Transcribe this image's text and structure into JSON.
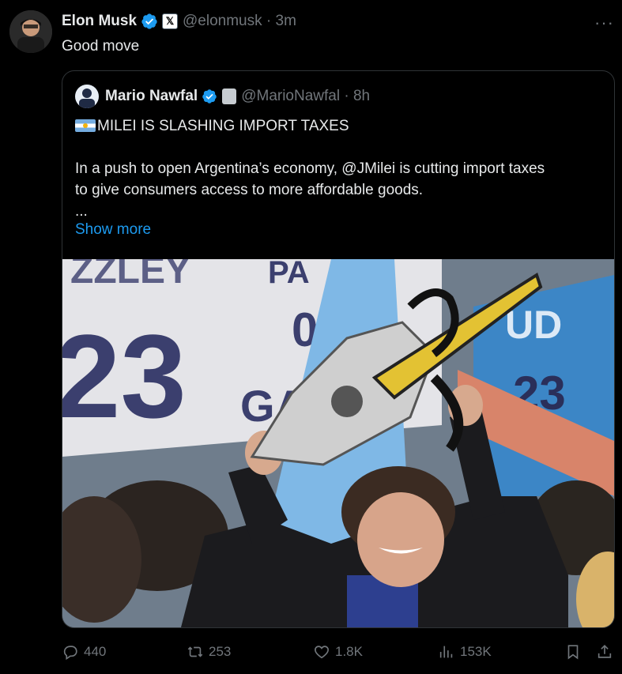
{
  "tweet": {
    "author_name": "Elon Musk",
    "handle": "@elonmusk",
    "separator": "·",
    "time": "3m",
    "text": "Good move",
    "more_icon": "more-horizontal-icon",
    "affiliation_badge": "𝕏"
  },
  "quoted": {
    "author_name": "Mario Nawfal",
    "handle": "@MarioNawfal",
    "separator": "·",
    "time": "8h",
    "headline": "MILEI IS SLASHING IMPORT TAXES",
    "line1": "In a push to open Argentina’s economy, @JMilei is cutting import taxes",
    "line2": "to give consumers access to more affordable goods.",
    "ellipsis": "...",
    "show_more": "Show more",
    "flag_icon": "argentina-flag-icon"
  },
  "actions": {
    "replies": "440",
    "reposts": "253",
    "likes": "1.8K",
    "views": "153K"
  },
  "colors": {
    "background": "#000000",
    "text": "#e7e9ea",
    "secondary": "#71767b",
    "accent": "#1d9bf0",
    "border": "#2f3336"
  }
}
